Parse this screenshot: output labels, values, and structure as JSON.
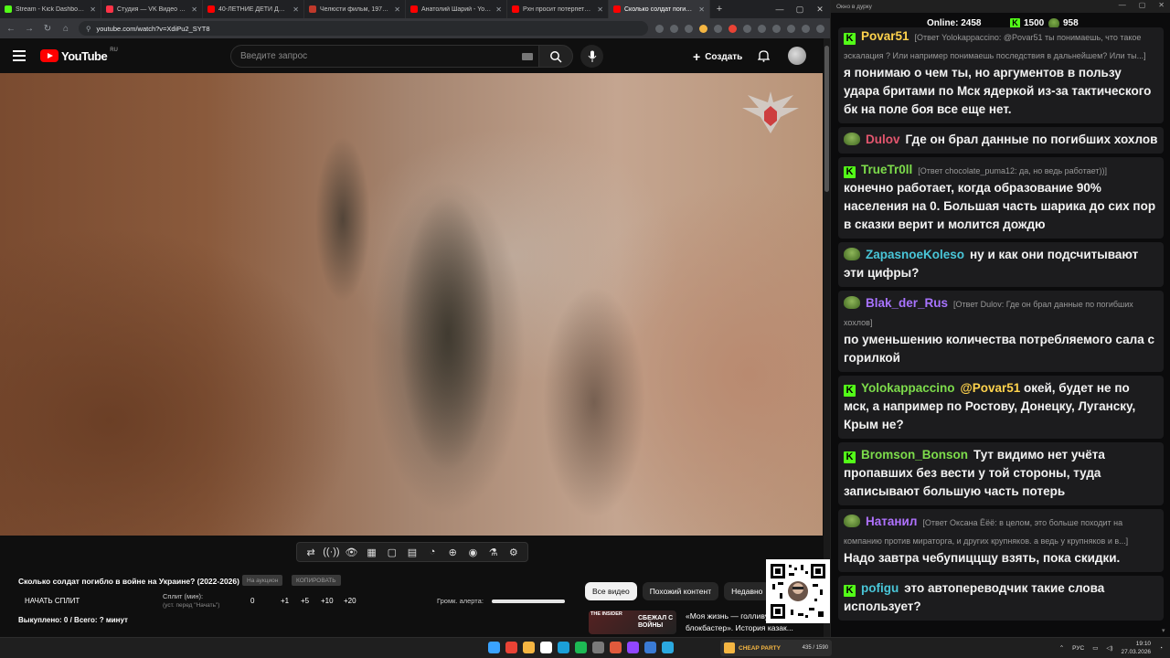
{
  "browser": {
    "tabs": [
      {
        "title": "Stream - Kick Dashboard",
        "favicon_color": "#53fc18",
        "active": false
      },
      {
        "title": "Студия — VK Видео Live",
        "favicon_color": "#ff3347",
        "active": false
      },
      {
        "title": "40-ЛЕТНИЕ ДЕТИ ДИСНЕЯ",
        "favicon_color": "#ff0000",
        "active": false
      },
      {
        "title": "Челюсти фильм, 1975, дата",
        "favicon_color": "#c0392b",
        "active": false
      },
      {
        "title": "Анатолий Шарий - YouTube",
        "favicon_color": "#ff0000",
        "active": false
      },
      {
        "title": "Рхн просит потерпеть :) - Y",
        "favicon_color": "#ff0000",
        "active": false
      },
      {
        "title": "Сколько солдат погибло в",
        "favicon_color": "#ff0000",
        "active": true
      }
    ],
    "url": "youtube.com/watch?v=XdiPu2_SYT8"
  },
  "youtube": {
    "logo_text": "YouTube",
    "region": "RU",
    "search_placeholder": "Введите запрос",
    "create_label": "Создать"
  },
  "video_tools": [
    "⇄",
    "((·))",
    "👁",
    "▦",
    "▢",
    "▤",
    "◔",
    "⊕",
    "◉",
    "⚗",
    "⚙"
  ],
  "below": {
    "title": "Сколько солдат погибло в войне на Украине? (2022-2026)",
    "btn_na_ochki": "На аукцион",
    "btn_copy": "КОПИРОВАТЬ",
    "split_start": "НАЧАТЬ СПЛИТ",
    "split_label": "Сплит (мин):",
    "split_sub": "(уст. перед \"Начать\")",
    "split_value": "0",
    "split_steps": [
      "+1",
      "+5",
      "+10",
      "+20"
    ],
    "alert_label": "Громк. алерта:",
    "alert_volume": 1.0,
    "bought": "Выкуплено: 0 / Всего: ? минут",
    "chips": [
      "Все видео",
      "Похожий контент",
      "Недавно"
    ],
    "rec_tag": "THE INSIDER",
    "rec_big": "СБЕЖАЛ С ВОЙНЫ",
    "rec_title": "«Моя жизнь — голливу... блокбастер». История казак..."
  },
  "chat": {
    "window_title": "Окно в дурку",
    "online_label": "Online:",
    "online_value": "2458",
    "kick_count": "1500",
    "other_count": "958",
    "messages": [
      {
        "author": "Povar51",
        "badge": "kick",
        "color": "#ffd34d",
        "reply": "[Ответ Yolokappaccino: @Povar51 ты понимаешь, что такое эскалация ? Или например понимаешь последствия в дальнейшем? Или ты...]",
        "text": "я понимаю о чем ты, но аргументов в пользу удара бритами по Мск ядеркой из-за тактического бк на поле боя все еще нет.",
        "mention": ""
      },
      {
        "author": "Dulov",
        "badge": "pepe",
        "color": "#e3566e",
        "reply": "",
        "text": "Где он брал данные  по погибших хохлов",
        "mention": ""
      },
      {
        "author": "TrueTr0ll",
        "badge": "kick",
        "color": "#7ddc4b",
        "reply": "[Ответ chocolate_puma12: да, но ведь работает))]",
        "text": "конечно работает, когда образование 90% населения на 0. Большая часть шарика до сих пор в сказки верит и молится дождю",
        "mention": ""
      },
      {
        "author": "ZapasnoeKoleso",
        "badge": "pepe",
        "color": "#49c6d8",
        "reply": "",
        "text": "ну и как они подсчитывают эти цифры?",
        "mention": ""
      },
      {
        "author": "Blak_der_Rus",
        "badge": "pepe",
        "color": "#a873ff",
        "reply": "[Ответ Dulov: Где он брал данные  по погибших хохлов]",
        "text": "по уменьшению количества потребляемого сала с горилкой",
        "mention": ""
      },
      {
        "author": "Yolokappaccino",
        "badge": "kick",
        "color": "#7ddc4b",
        "reply": "",
        "text": "окей, будет не по мск, а например по Ростову, Донецку, Луганску, Крым не?",
        "mention": "@Povar51"
      },
      {
        "author": "Bromson_Bonson",
        "badge": "kick",
        "color": "#7ddc4b",
        "reply": "",
        "text": "Тут видимо нет учёта пропавших без вести у той стороны, туда записывают большую часть потерь",
        "mention": ""
      },
      {
        "author": "Натанил",
        "badge": "pepe",
        "color": "#b072ff",
        "reply": "[Ответ Оксана Ёёё: в целом, это больше походит на компанию против мираторга, и других крупняков. а ведь у крупняков и в...]",
        "text": "Надо завтра чебупиццщу взять, пока скидки.",
        "mention": ""
      },
      {
        "author": "pofigu",
        "badge": "kick",
        "color": "#49c6d8",
        "reply": "",
        "text": "это автопереводчик такие слова использует?",
        "mention": ""
      }
    ]
  },
  "taskbar": {
    "widget_logo": "CHEAP PARTY",
    "widget_count": "435 / 1590",
    "lang": "РУС",
    "time": "19:10",
    "date": "27.03.2026",
    "icon_colors": [
      "#3aa3ff",
      "#ea4335",
      "#f5b642",
      "#ffffff",
      "#1b9fd8",
      "#1db954",
      "#7a7a7a",
      "#e05a3c",
      "#9146ff",
      "#3a7bd5",
      "#2ba9e0"
    ]
  },
  "colors": {
    "kick_green": "#53fc18",
    "yt_red": "#ff0000",
    "chat_bubble": "#1c1c1e"
  }
}
